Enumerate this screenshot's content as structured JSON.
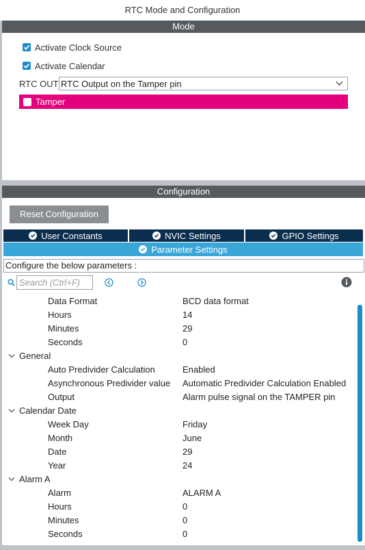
{
  "window": {
    "title": "RTC Mode and Configuration"
  },
  "mode": {
    "header": "Mode",
    "activate_clock_source": {
      "label": "Activate Clock Source",
      "checked": true
    },
    "activate_calendar": {
      "label": "Activate Calendar",
      "checked": true
    },
    "rtc_out": {
      "label": "RTC OUT",
      "value": "RTC Output on the Tamper pin"
    },
    "tamper": {
      "label": "Tamper",
      "checked": false,
      "highlight_color": "#e4007c"
    }
  },
  "configuration": {
    "header": "Configuration",
    "reset_button": "Reset Configuration",
    "tabs": [
      {
        "label": "User Constants"
      },
      {
        "label": "NVIC Settings"
      },
      {
        "label": "GPIO Settings"
      }
    ],
    "active_tab": {
      "label": "Parameter Settings"
    },
    "description": "Configure the below parameters :",
    "search_placeholder": "Search (Ctrl+F)",
    "params": [
      {
        "label": "Data Format",
        "value": "BCD data format"
      },
      {
        "label": "Hours",
        "value": "14"
      },
      {
        "label": "Minutes",
        "value": "29"
      },
      {
        "label": "Seconds",
        "value": "0"
      },
      {
        "group": "General"
      },
      {
        "label": "Auto Predivider Calculation",
        "value": "Enabled"
      },
      {
        "label": "Asynchronous Predivider value",
        "value": "Automatic Predivider Calculation Enabled"
      },
      {
        "label": "Output",
        "value": "Alarm pulse signal on the TAMPER pin"
      },
      {
        "group": "Calendar Date"
      },
      {
        "label": "Week Day",
        "value": "Friday"
      },
      {
        "label": "Month",
        "value": "June"
      },
      {
        "label": "Date",
        "value": "29"
      },
      {
        "label": "Year",
        "value": "24"
      },
      {
        "group": "Alarm A"
      },
      {
        "label": "Alarm",
        "value": "ALARM A"
      },
      {
        "label": "Hours",
        "value": "0"
      },
      {
        "label": "Minutes",
        "value": "0"
      },
      {
        "label": "Seconds",
        "value": "0"
      }
    ]
  },
  "colors": {
    "accent": "#1e8bc9",
    "tab_dark": "#0b2d4e",
    "tab_active": "#3aa6d8",
    "band": "#555a5f"
  }
}
